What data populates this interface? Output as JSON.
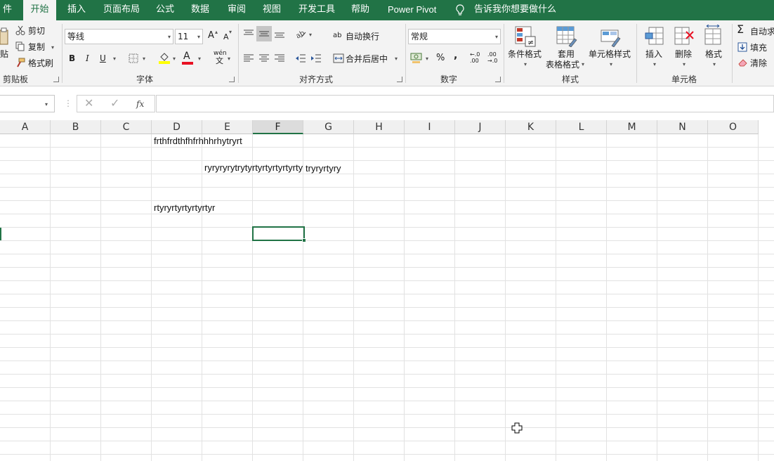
{
  "tabs": [
    {
      "label": "件",
      "active": false
    },
    {
      "label": "开始",
      "active": true
    },
    {
      "label": "插入",
      "active": false
    },
    {
      "label": "页面布局",
      "active": false
    },
    {
      "label": "公式",
      "active": false
    },
    {
      "label": "数据",
      "active": false
    },
    {
      "label": "审阅",
      "active": false
    },
    {
      "label": "视图",
      "active": false
    },
    {
      "label": "开发工具",
      "active": false
    },
    {
      "label": "帮助",
      "active": false
    },
    {
      "label": "Power Pivot",
      "active": false
    }
  ],
  "tell_me": {
    "text": "告诉我你想要做什么",
    "icon": "lightbulb-icon"
  },
  "clipboard": {
    "paste": "贴",
    "cut": "剪切",
    "copy": "复制",
    "format_painter": "格式刷",
    "group_label": "剪贴板"
  },
  "font": {
    "name": "等线",
    "size": "11",
    "bold": "B",
    "italic": "I",
    "underline": "U",
    "grow": "A",
    "shrink": "A",
    "color_letter": "A",
    "wen_top": "wén",
    "wen_bottom": "文",
    "group_label": "字体",
    "fill_color": "#ffff00",
    "font_color": "#e81123"
  },
  "alignment": {
    "wrap": "自动换行",
    "wrap_icon_text": "ab",
    "merge": "合并后居中",
    "group_label": "对齐方式"
  },
  "number": {
    "format": "常规",
    "percent": "%",
    "comma": ",",
    "inc_decimal": "←.0\n.00",
    "dec_decimal": ".00\n→.0",
    "group_label": "数字"
  },
  "styles": {
    "conditional": "条件格式",
    "table_line1": "套用",
    "table_line2": "表格格式",
    "cell_styles": "单元格样式",
    "group_label": "样式"
  },
  "cells": {
    "insert": "插入",
    "delete": "删除",
    "format": "格式",
    "group_label": "单元格"
  },
  "editing": {
    "autosum": "自动求",
    "fill": "填充",
    "clear": "清除"
  },
  "formula_bar": {
    "name_box": "",
    "fx": "fx",
    "content": ""
  },
  "columns": [
    "A",
    "B",
    "C",
    "D",
    "E",
    "F",
    "G",
    "H",
    "I",
    "J",
    "K",
    "L",
    "M",
    "N",
    "O"
  ],
  "selected_column": "F",
  "cells_data": [
    {
      "ref": "D1",
      "text": "frthfrdthfhfrhhhrhytryrt"
    },
    {
      "ref": "E3",
      "text": "ryryryrytrytyrtyrtyrtyrtyrtyr"
    },
    {
      "ref": "G3",
      "text": "tryryrtyry"
    },
    {
      "ref": "D6",
      "text": "rtyryrtyrtyrtyrtyr"
    }
  ],
  "active_cell": "F8",
  "colors": {
    "accent": "#217346",
    "ribbon": "#f3f3f3",
    "grid_line": "#e2e2e2"
  }
}
